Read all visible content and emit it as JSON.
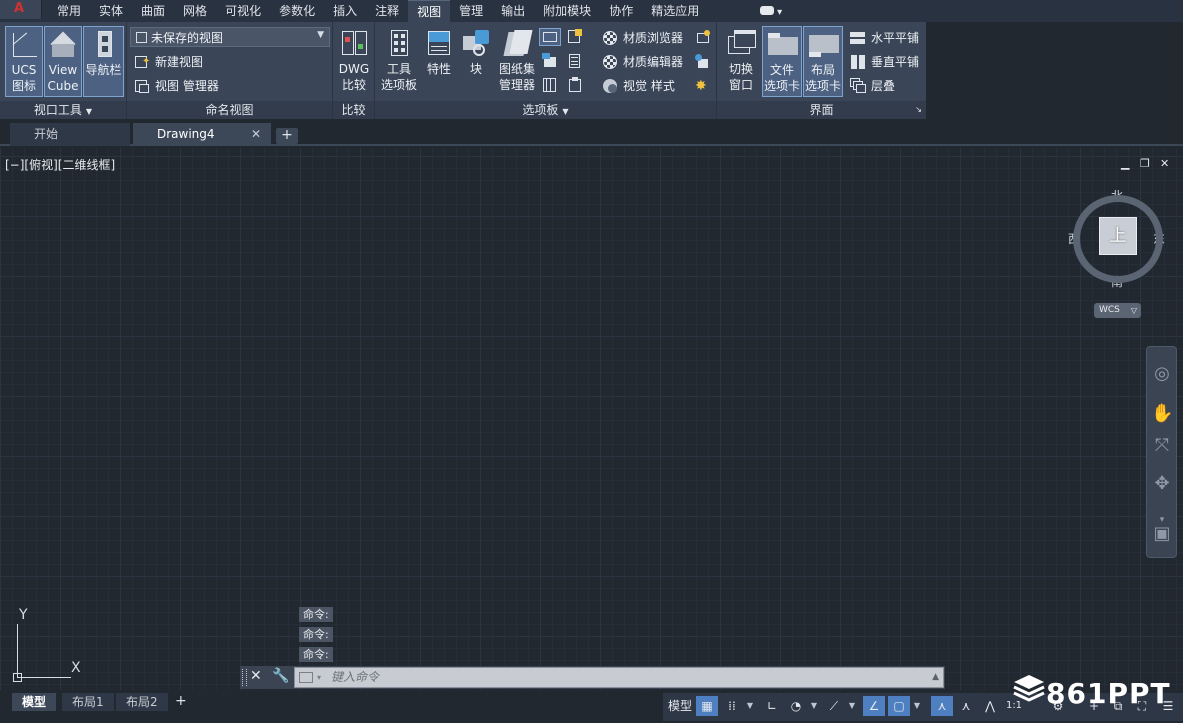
{
  "app": {
    "logo_letter": "A"
  },
  "ribbon_tabs": [
    "常用",
    "实体",
    "曲面",
    "网格",
    "可视化",
    "参数化",
    "插入",
    "注释",
    "视图",
    "管理",
    "输出",
    "附加模块",
    "协作",
    "精选应用"
  ],
  "active_ribbon_tab": "视图",
  "panels": {
    "viewport_tools": {
      "title": "视口工具",
      "ucs_icon": [
        "UCS",
        "图标"
      ],
      "view_cube": [
        "View",
        "Cube"
      ],
      "nav_bar": "导航栏"
    },
    "named_views": {
      "title": "命名视图",
      "combo_value": "未保存的视图",
      "new_view": "新建视图",
      "view_manager": "视图 管理器"
    },
    "compare": {
      "title": "比较",
      "dwg_compare": [
        "DWG",
        "比较"
      ]
    },
    "palettes": {
      "title": "选项板",
      "tool_palettes": [
        "工具",
        "选项板"
      ],
      "properties": "特性",
      "block": "块",
      "sheet_set": [
        "图纸集",
        "管理器"
      ],
      "materials_browser": "材质浏览器",
      "materials_editor": "材质编辑器",
      "visual_styles": "视觉 样式"
    },
    "interface": {
      "title": "界面",
      "switch_windows": [
        "切换",
        "窗口"
      ],
      "file_tabs": [
        "文件",
        "选项卡"
      ],
      "layout_tabs": [
        "布局",
        "选项卡"
      ],
      "tile_horizontal": "水平平铺",
      "tile_vertical": "垂直平铺",
      "cascade": "层叠"
    }
  },
  "file_tabs": {
    "start": "开始",
    "drawing": "Drawing4"
  },
  "viewport": {
    "label": "[−][俯视][二维线框]",
    "viewcube": {
      "top_face": "上",
      "north": "北",
      "south": "南",
      "east": "东",
      "west": "西",
      "wcs": "WCS"
    },
    "ucs": {
      "x": "X",
      "y": "Y"
    }
  },
  "command": {
    "history": [
      "命令:",
      "命令:",
      "命令:"
    ],
    "placeholder": "键入命令"
  },
  "layout_tabs": [
    "模型",
    "布局1",
    "布局2"
  ],
  "status": {
    "model": "模型",
    "scale": "1:1"
  },
  "watermark": "861PPT"
}
